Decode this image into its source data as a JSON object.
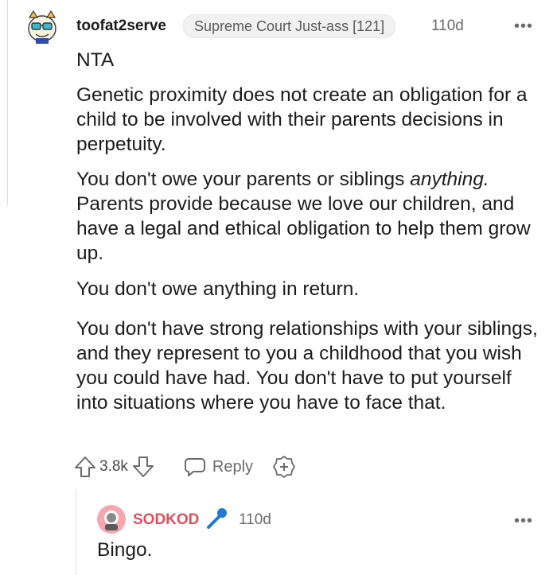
{
  "comment": {
    "username": "toofat2serve",
    "flair": "Supreme Court Just-ass [121]",
    "age": "110d",
    "more": "•••",
    "paragraphs": [
      "NTA",
      "Genetic proximity does not create an obligation for a child to be involved with their parents decisions in perpetuity.",
      "You don't owe your parents or siblings",
      "anything.",
      "Parents provide because we love our children, and have a legal and ethical obligation to help them grow up.",
      "You don't owe anything in return.",
      "You don't have strong relationships with your siblings, and they represent to you a childhood that you wish you could have had. You don't have to put yourself into situations where you have to face that."
    ],
    "votes": "3.8k",
    "reply_label": "Reply"
  },
  "reply": {
    "username": "SODKOD",
    "age": "110d",
    "more": "•••",
    "body": "Bingo."
  },
  "colors": {
    "reply_username": "#e0505a",
    "mic_icon": "#1f78d1",
    "reply_avatar_bg": "#f5a7b0"
  }
}
